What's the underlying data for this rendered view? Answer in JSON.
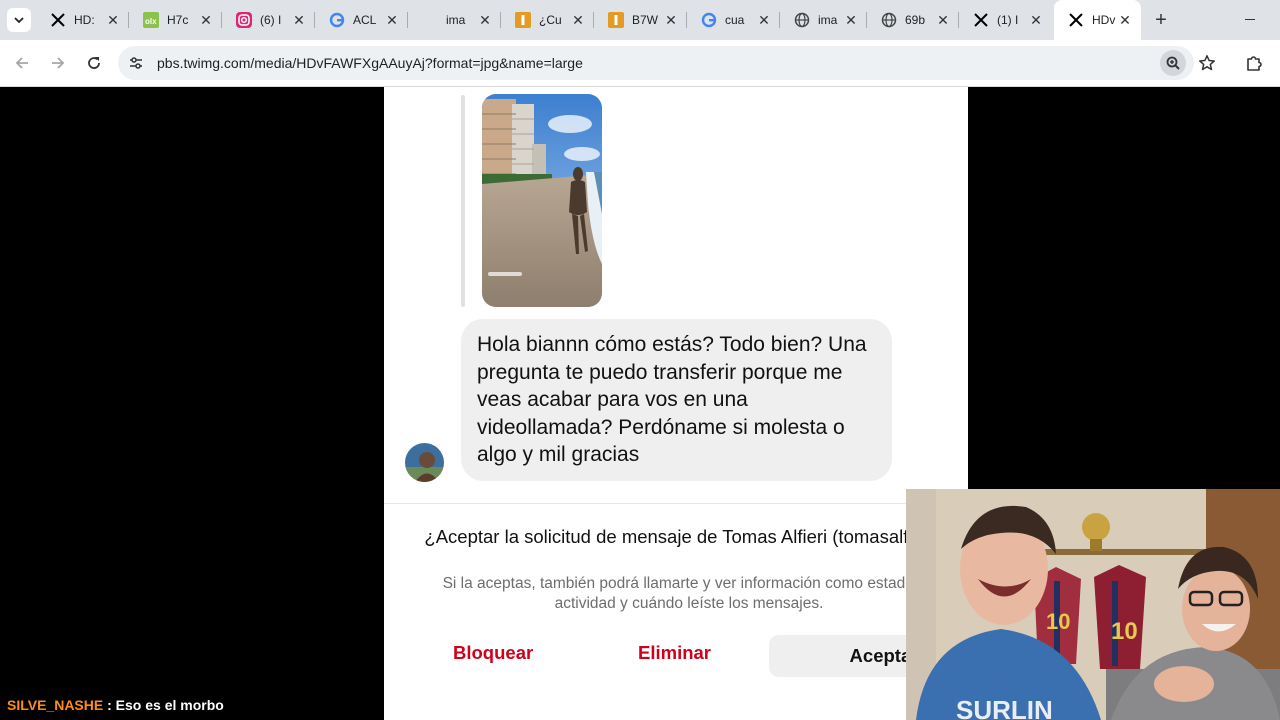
{
  "browser": {
    "tabs": [
      {
        "title": "HD:",
        "icon": "x-logo-icon"
      },
      {
        "title": "H7c",
        "icon": "olx-icon"
      },
      {
        "title": "(6) I",
        "icon": "instagram-icon"
      },
      {
        "title": "ACL",
        "icon": "google-icon"
      },
      {
        "title": "ima",
        "icon": "blank-icon"
      },
      {
        "title": "¿Cu",
        "icon": "imgur-icon"
      },
      {
        "title": "B7W",
        "icon": "imgur-icon"
      },
      {
        "title": "cua",
        "icon": "google-icon"
      },
      {
        "title": "ima",
        "icon": "globe-icon"
      },
      {
        "title": "69b",
        "icon": "globe-icon"
      },
      {
        "title": "(1) I",
        "icon": "x-logo-icon"
      },
      {
        "title": "HDv",
        "icon": "x-logo-icon",
        "active": true
      }
    ],
    "url": "pbs.twimg.com/media/HDvFAWFXgAAuyAj?format=jpg&name=large"
  },
  "dm": {
    "message": "Hola biannn cómo estás? Todo bien? Una pregunta te puedo transferir porque me veas acabar para vos en una videollamada? Perdóname si molesta o algo y mil gracias",
    "photo_watermark": "",
    "request_title": "¿Aceptar la solicitud de mensaje de Tomas Alfieri (tomasalfierii)?",
    "request_subtitle": "Si la aceptas, también podrá llamarte y ver información como estado de actividad y cuándo leíste los mensajes.",
    "block_label": "Bloquear",
    "delete_label": "Eliminar",
    "accept_label": "Aceptar",
    "danger_color": "#d0021b"
  },
  "chat": {
    "user": "SILVE_NASHE",
    "separator": " : ",
    "message": "Eso es el morbo",
    "user_color": "#ff8c1a"
  }
}
